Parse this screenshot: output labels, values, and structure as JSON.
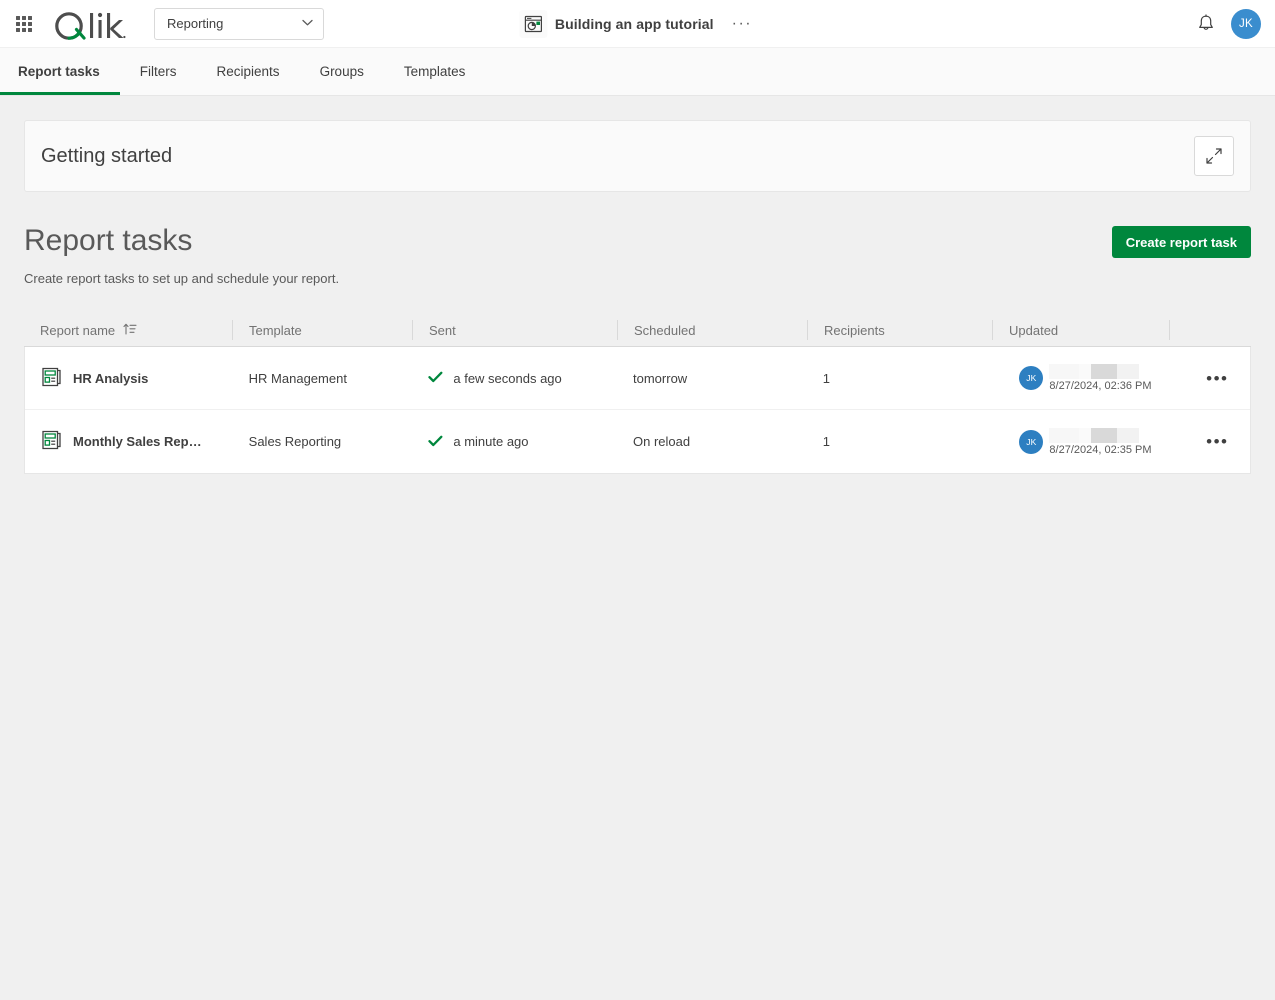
{
  "topbar": {
    "launcher_label": "app-launcher",
    "logo_text": "Qlik",
    "space": {
      "value": "Reporting",
      "chevron": "⌄"
    },
    "app": {
      "title": "Building an app tutorial",
      "menu_dots": "···"
    },
    "notifications_label": "Notifications",
    "avatar_initials": "JK"
  },
  "tabs": [
    {
      "label": "Report tasks",
      "active": true
    },
    {
      "label": "Filters",
      "active": false
    },
    {
      "label": "Recipients",
      "active": false
    },
    {
      "label": "Groups",
      "active": false
    },
    {
      "label": "Templates",
      "active": false
    }
  ],
  "getting_started": {
    "title": "Getting started",
    "expand_label": "Expand"
  },
  "page": {
    "title": "Report tasks",
    "subtitle": "Create report tasks to set up and schedule your report.",
    "create_button": "Create report task"
  },
  "table": {
    "columns": [
      {
        "label": "Report name",
        "sort": "ascending"
      },
      {
        "label": "Template"
      },
      {
        "label": "Sent"
      },
      {
        "label": "Scheduled"
      },
      {
        "label": "Recipients"
      },
      {
        "label": "Updated"
      },
      {
        "label": ""
      }
    ],
    "rows": [
      {
        "name": "HR Analysis",
        "template": "HR Management",
        "sent": "a few seconds ago",
        "sent_status": "success",
        "scheduled": "tomorrow",
        "recipients": "1",
        "updated_by_initials": "JK",
        "updated_by_name": "",
        "updated_time": "8/27/2024, 02:36 PM",
        "menu": "•••"
      },
      {
        "name": "Monthly Sales Rep…",
        "template": "Sales Reporting",
        "sent": "a minute ago",
        "sent_status": "success",
        "scheduled": "On reload",
        "recipients": "1",
        "updated_by_initials": "JK",
        "updated_by_name": "",
        "updated_time": "8/27/2024, 02:35 PM",
        "menu": "•••"
      }
    ]
  },
  "colors": {
    "brand_green": "#00873d",
    "avatar_blue": "#3a8dce",
    "page_bg": "#f0f0f0",
    "text": "#404040",
    "muted_text": "#737373"
  }
}
